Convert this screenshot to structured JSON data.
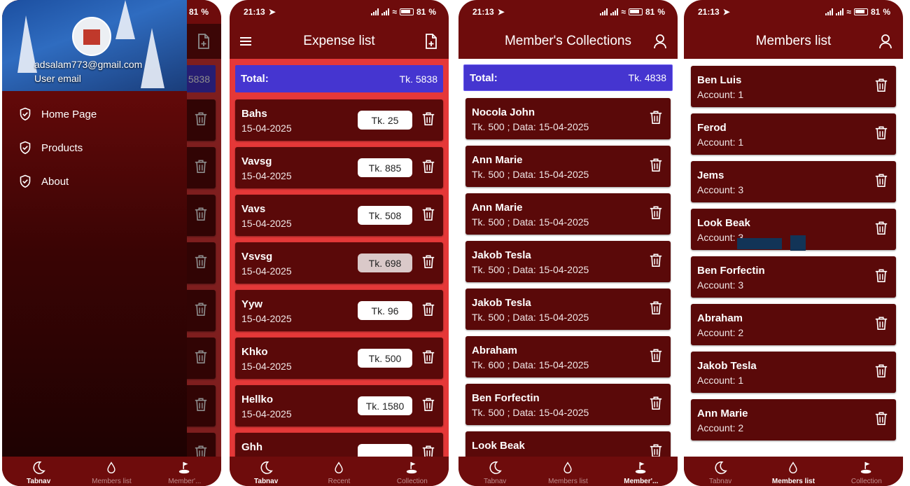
{
  "status": {
    "time": "21:13",
    "battery": "81"
  },
  "phone1": {
    "drawer": {
      "email": "adsalam773@gmail.com",
      "user_label": "User email",
      "items": [
        {
          "label": "Home Page",
          "icon": "shield-check-icon"
        },
        {
          "label": "Products",
          "icon": "shield-check-icon"
        },
        {
          "label": "About",
          "icon": "shield-check-icon"
        }
      ]
    },
    "underlay_total": "5838",
    "nav": [
      {
        "label": "Tabnav",
        "icon": "moon-icon",
        "active": true
      },
      {
        "label": "Members list",
        "icon": "drop-icon",
        "active": false
      },
      {
        "label": "Member'...",
        "icon": "flag-icon",
        "active": false
      }
    ]
  },
  "phone2": {
    "title": "Expense list",
    "total_label": "Total:",
    "total_value": "Tk. 5838",
    "items": [
      {
        "name": "Bahs",
        "date": "15-04-2025",
        "amount": "Tk. 25"
      },
      {
        "name": "Vavsg",
        "date": "15-04-2025",
        "amount": "Tk. 885"
      },
      {
        "name": "Vavs",
        "date": "15-04-2025",
        "amount": "Tk. 508"
      },
      {
        "name": "Vsvsg",
        "date": "15-04-2025",
        "amount": "Tk. 698"
      },
      {
        "name": "Yyw",
        "date": "15-04-2025",
        "amount": "Tk. 96"
      },
      {
        "name": "Khko",
        "date": "15-04-2025",
        "amount": "Tk. 500"
      },
      {
        "name": "Hellko",
        "date": "15-04-2025",
        "amount": "Tk. 1580"
      },
      {
        "name": "Ghh",
        "date": "",
        "amount": ""
      }
    ],
    "nav": [
      {
        "label": "Tabnav",
        "icon": "moon-icon",
        "active": true
      },
      {
        "label": "Recent",
        "icon": "drop-icon",
        "active": false
      },
      {
        "label": "Collection",
        "icon": "flag-icon",
        "active": false
      }
    ]
  },
  "phone3": {
    "title": "Member's Collections",
    "total_label": "Total:",
    "total_value": "Tk. 4838",
    "items": [
      {
        "name": "Nocola John",
        "detail": "Tk. 500 ; Data: 15-04-2025"
      },
      {
        "name": "Ann Marie",
        "detail": "Tk. 500 ; Data: 15-04-2025"
      },
      {
        "name": "Ann Marie",
        "detail": "Tk. 500 ; Data: 15-04-2025"
      },
      {
        "name": "Jakob Tesla",
        "detail": "Tk. 500 ; Data: 15-04-2025"
      },
      {
        "name": "Jakob Tesla",
        "detail": "Tk. 500 ; Data: 15-04-2025"
      },
      {
        "name": "Abraham",
        "detail": "Tk. 600 ; Data: 15-04-2025"
      },
      {
        "name": "Ben Forfectin",
        "detail": "Tk. 500 ; Data: 15-04-2025"
      },
      {
        "name": "Look Beak",
        "detail": ""
      }
    ],
    "nav": [
      {
        "label": "Tabnav",
        "icon": "moon-icon",
        "active": false
      },
      {
        "label": "Members list",
        "icon": "drop-icon",
        "active": false
      },
      {
        "label": "Member'...",
        "icon": "flag-icon",
        "active": true
      }
    ]
  },
  "phone4": {
    "title": "Members list",
    "items": [
      {
        "name": "Ben Luis",
        "detail": "Account: 1"
      },
      {
        "name": "Ferod",
        "detail": "Account: 1"
      },
      {
        "name": "Jems",
        "detail": "Account: 3"
      },
      {
        "name": "Look Beak",
        "detail": "Account: 3"
      },
      {
        "name": "Ben Forfectin",
        "detail": "Account: 3"
      },
      {
        "name": "Abraham",
        "detail": "Account: 2"
      },
      {
        "name": "Jakob Tesla",
        "detail": "Account: 1"
      },
      {
        "name": "Ann Marie",
        "detail": "Account: 2"
      }
    ],
    "nav": [
      {
        "label": "Tabnav",
        "icon": "moon-icon",
        "active": false
      },
      {
        "label": "Members list",
        "icon": "drop-icon",
        "active": true
      },
      {
        "label": "Collection",
        "icon": "flag-icon",
        "active": false
      }
    ]
  }
}
